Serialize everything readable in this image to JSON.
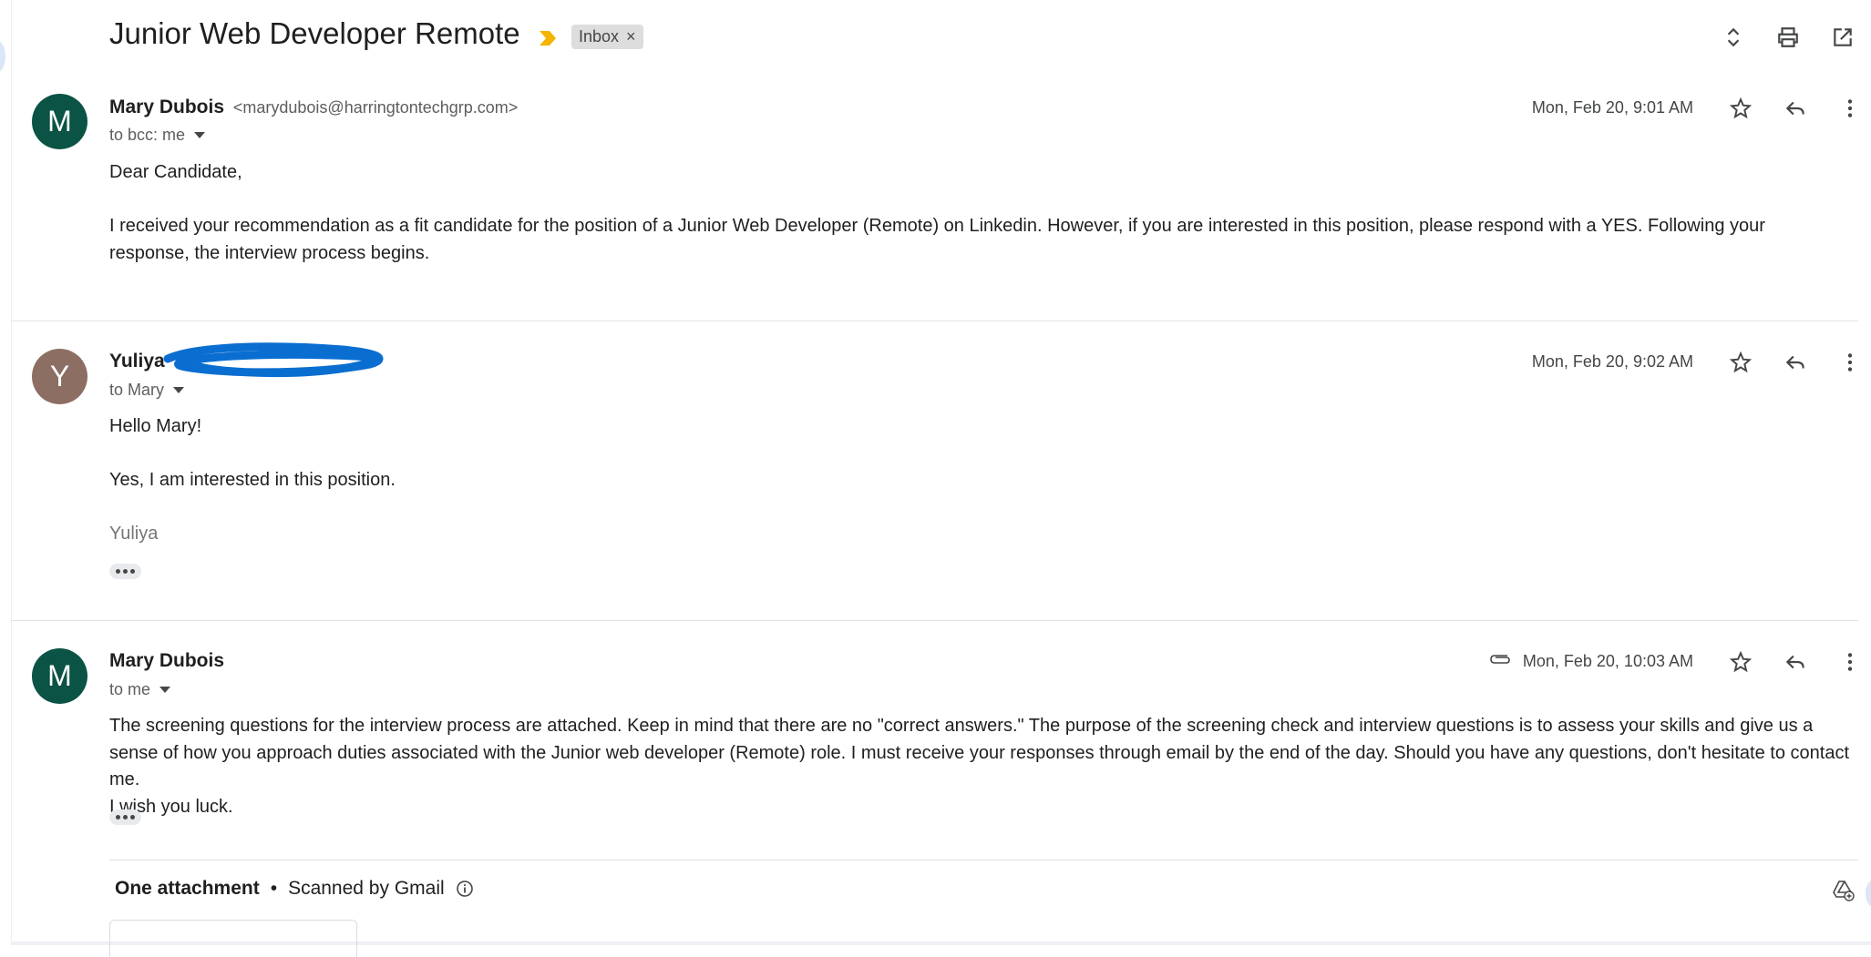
{
  "thread": {
    "subject": "Junior Web Developer Remote",
    "label": "Inbox",
    "label_remove": "×",
    "icons": [
      "expand-collapse-icon",
      "print-icon",
      "open-new-window-icon"
    ]
  },
  "messages": [
    {
      "avatar_letter": "M",
      "avatar_color": "#0b5345",
      "sender_name": "Mary Dubois",
      "sender_email": "<marydubois@harringtontechgrp.com>",
      "to": "to bcc: me",
      "date": "Mon, Feb 20, 9:01 AM",
      "body": [
        "Dear Candidate,",
        "I received your recommendation as a fit candidate for the position of a Junior Web Developer (Remote) on Linkedin. However, if you are interested in this position, please respond with a YES. Following your response, the interview process begins."
      ]
    },
    {
      "avatar_letter": "Y",
      "avatar_color": "#8d6e63",
      "sender_name": "Yuliya",
      "to": "to Mary",
      "date": "Mon, Feb 20, 9:02 AM",
      "body": [
        "Hello Mary!",
        "Yes, I am interested in this position."
      ],
      "signature": "Yuliya"
    },
    {
      "avatar_letter": "M",
      "avatar_color": "#0b5345",
      "sender_name": "Mary Dubois",
      "to": "to me",
      "date": "Mon, Feb 20, 10:03 AM",
      "has_attachment": true,
      "body": [
        "The screening questions for the interview process are attached. Keep in mind that there are no \"correct answers.\" The purpose of the screening check and interview questions is to assess your skills and give us a sense of how you approach duties associated with the Junior web developer (Remote) role. I must receive your responses through email by the end of the day. Should you have any questions, don't hesitate to contact me.",
        "I wish you luck."
      ]
    }
  ],
  "attachments": {
    "count_label": "One attachment",
    "separator": "•",
    "scan_label": "Scanned by Gmail"
  },
  "colors": {
    "importance": "#f4b400",
    "chip_bg": "#dddddd",
    "redaction": "#0a6ed1"
  }
}
